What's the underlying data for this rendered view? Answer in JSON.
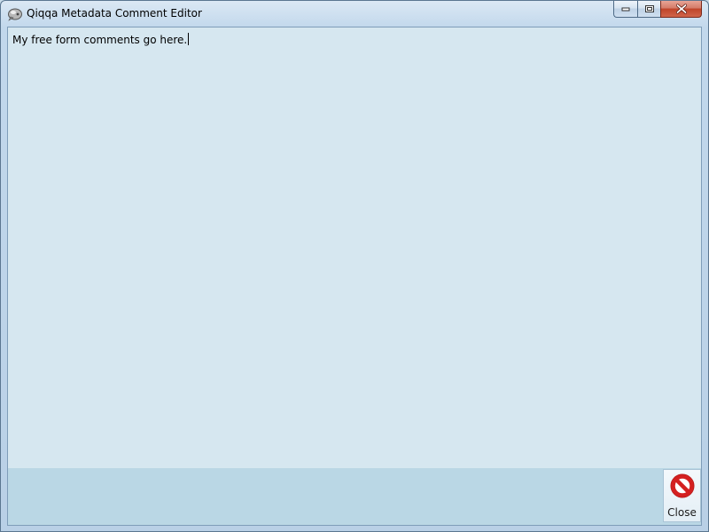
{
  "window": {
    "title": "Qiqqa Metadata Comment Editor",
    "app_icon": "qiqqa-app-icon"
  },
  "caption_buttons": {
    "minimize_icon": "minimize-icon",
    "maximize_icon": "restore-icon",
    "close_icon": "close-icon"
  },
  "editor": {
    "value": "My free form comments go here."
  },
  "toolbar": {
    "close_label": "Close",
    "close_icon": "no-entry-icon"
  },
  "colors": {
    "editor_background": "#d6e7f0",
    "bottom_bar_background": "#bad7e5",
    "close_icon_red": "#cc1f1f"
  }
}
